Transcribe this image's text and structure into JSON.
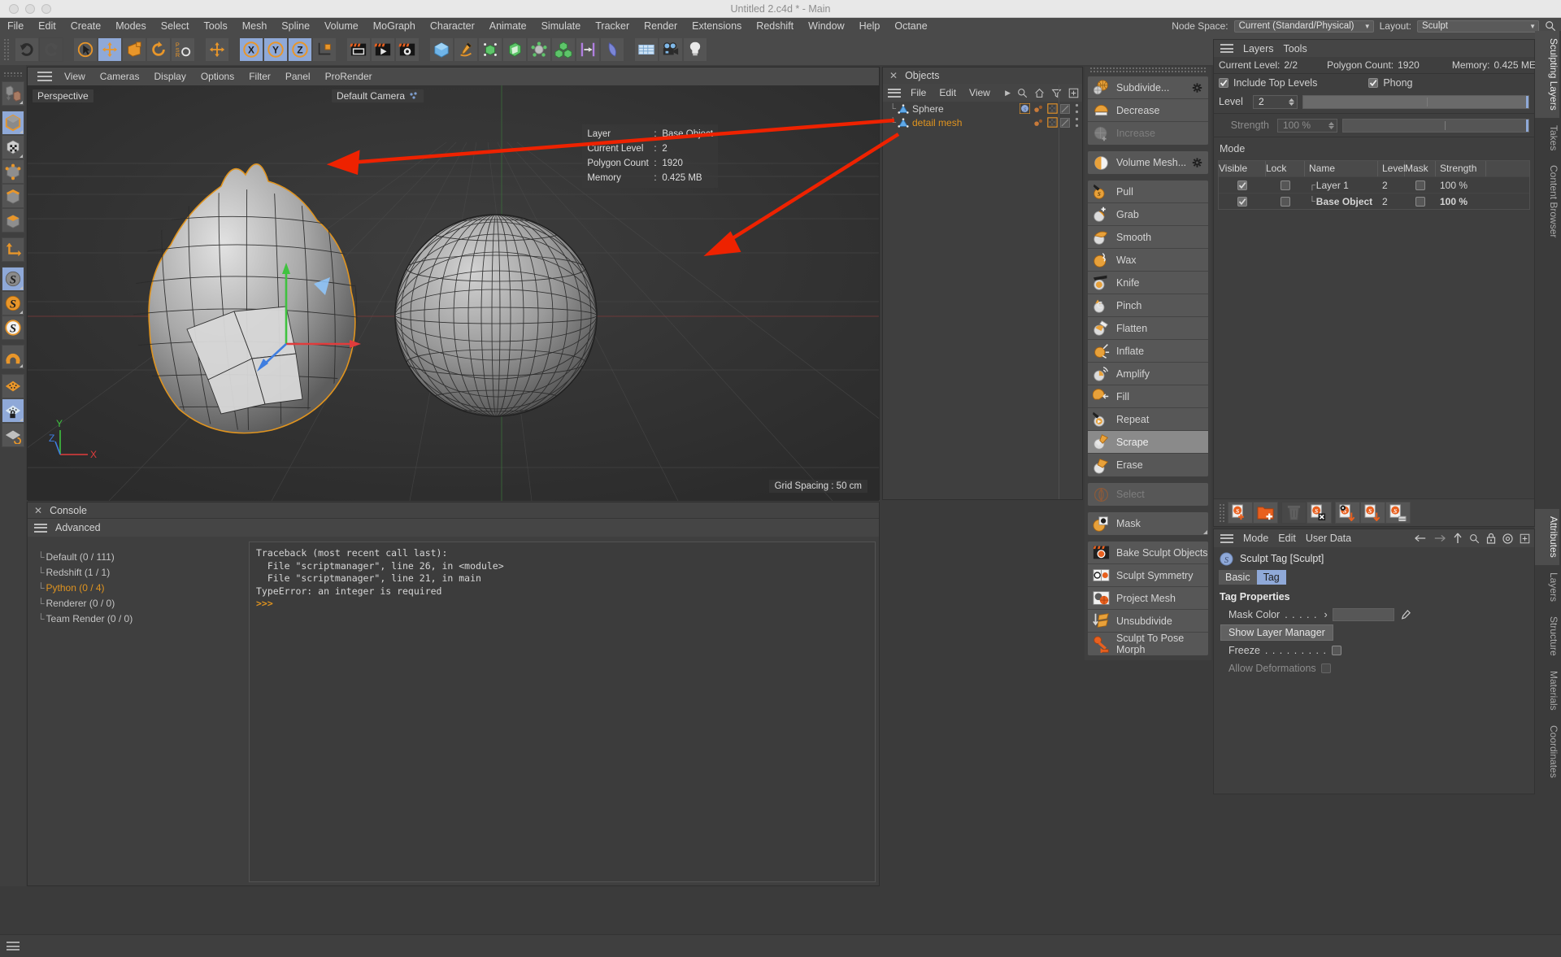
{
  "window": {
    "title": "Untitled 2.c4d * - Main"
  },
  "menubar": {
    "items": [
      "File",
      "Edit",
      "Create",
      "Modes",
      "Select",
      "Tools",
      "Mesh",
      "Spline",
      "Volume",
      "MoGraph",
      "Character",
      "Animate",
      "Simulate",
      "Tracker",
      "Render",
      "Extensions",
      "Redshift",
      "Window",
      "Help",
      "Octane"
    ],
    "node_space_label": "Node Space:",
    "node_space_value": "Current (Standard/Physical)",
    "layout_label": "Layout:",
    "layout_value": "Sculpt",
    "search_icon": "magnifier-icon"
  },
  "toolbar": {
    "groups": [
      {
        "name": "history",
        "buttons": [
          {
            "icon": "undo-icon",
            "label": "Undo",
            "active": false,
            "dim": false
          },
          {
            "icon": "redo-icon",
            "label": "Redo",
            "active": false,
            "dim": true
          }
        ]
      },
      {
        "name": "transform",
        "buttons": [
          {
            "icon": "select-cursor-icon",
            "label": "Live Selection",
            "active": false,
            "dim": false
          },
          {
            "icon": "move-icon",
            "label": "Move",
            "active": true,
            "dim": false
          },
          {
            "icon": "scale-icon",
            "label": "Scale",
            "active": false,
            "dim": false
          },
          {
            "icon": "rotate-icon",
            "label": "Rotate",
            "active": false,
            "dim": false
          },
          {
            "icon": "psr-icon",
            "label": "PSR",
            "active": false,
            "dim": false
          }
        ]
      },
      {
        "name": "world-object",
        "buttons": [
          {
            "icon": "coordinate-move-icon",
            "label": "World/Object",
            "active": false,
            "dim": false
          }
        ]
      },
      {
        "name": "axis-locks",
        "buttons": [
          {
            "icon": "x-axis-icon",
            "label": "X Axis",
            "active": true,
            "dim": false
          },
          {
            "icon": "y-axis-icon",
            "label": "Y Axis",
            "active": true,
            "dim": false
          },
          {
            "icon": "z-axis-icon",
            "label": "Z Axis",
            "active": true,
            "dim": false
          },
          {
            "icon": "world-coordinate-icon",
            "label": "World Coordinates",
            "active": false,
            "dim": false
          }
        ]
      },
      {
        "name": "render",
        "buttons": [
          {
            "icon": "render-view-icon",
            "label": "Render View",
            "active": false,
            "dim": false
          },
          {
            "icon": "render-queue-icon",
            "label": "Render to Picture Viewer",
            "active": false,
            "dim": false
          },
          {
            "icon": "render-settings-icon",
            "label": "Edit Render Settings",
            "active": false,
            "dim": false
          }
        ]
      },
      {
        "name": "create",
        "buttons": [
          {
            "icon": "cube-primitive-icon",
            "label": "Add Cube Object",
            "active": false,
            "dim": false
          },
          {
            "icon": "pen-spline-icon",
            "label": "Add Spline",
            "active": false,
            "dim": false
          },
          {
            "icon": "nurbs-icon",
            "label": "Add Generator",
            "active": false,
            "dim": false
          },
          {
            "icon": "array-icon",
            "label": "Add Modeling Object",
            "active": false,
            "dim": false
          },
          {
            "icon": "deformer-icon",
            "label": "Add Deformer",
            "active": false,
            "dim": false
          },
          {
            "icon": "cloner-icon",
            "label": "Add MoGraph Object",
            "active": false,
            "dim": false
          },
          {
            "icon": "field-icon",
            "label": "Add Field",
            "active": false,
            "dim": false
          },
          {
            "icon": "bend-icon",
            "label": "Add Deformer Object",
            "active": false,
            "dim": false
          }
        ]
      },
      {
        "name": "scene",
        "buttons": [
          {
            "icon": "floor-icon",
            "label": "Add Floor",
            "active": false,
            "dim": false
          },
          {
            "icon": "camera-icon",
            "label": "Add Camera",
            "active": false,
            "dim": false
          },
          {
            "icon": "light-icon",
            "label": "Add Light",
            "active": false,
            "dim": false
          }
        ]
      }
    ]
  },
  "left_tools": [
    {
      "icon": "make-editable-icon",
      "label": "Make Editable",
      "active": false
    },
    {
      "icon": "model-mode-icon",
      "label": "Model Mode",
      "active": true
    },
    {
      "icon": "texture-mode-icon",
      "label": "Texture Mode",
      "active": false
    },
    {
      "icon": "points-mode-icon",
      "label": "Points Mode",
      "active": false
    },
    {
      "icon": "edges-mode-icon",
      "label": "Edges Mode",
      "active": false
    },
    {
      "icon": "polygons-mode-icon",
      "label": "Polygons Mode",
      "active": false
    },
    {
      "icon": "axis-mode-icon",
      "label": "Enable Axis",
      "active": false
    },
    {
      "icon": "sculpt-mode-icon",
      "label": "Sculpt Mode",
      "active": true
    },
    {
      "icon": "sculpt-brush-icon",
      "label": "Sculpt Brush",
      "active": false
    },
    {
      "icon": "sculpt-symmetry-icon",
      "label": "Sculpt Symmetry",
      "active": false
    },
    {
      "icon": "magnet-icon",
      "label": "Magnet",
      "active": false
    },
    {
      "icon": "workplane-icon",
      "label": "Workplane",
      "active": false
    },
    {
      "icon": "lock-workplane-icon",
      "label": "Lock Workplane",
      "active": true
    },
    {
      "icon": "workplane-mode-icon",
      "label": "Planar Workplane",
      "active": false
    }
  ],
  "viewport": {
    "menu": [
      "View",
      "Cameras",
      "Display",
      "Options",
      "Filter",
      "Panel",
      "ProRender"
    ],
    "label": "Perspective",
    "camera": "Default Camera",
    "camera_icon": "camera-dots-icon",
    "hud": [
      {
        "key": "Layer",
        "value": "Base Object"
      },
      {
        "key": "Current Level",
        "value": "2"
      },
      {
        "key": "Polygon Count",
        "value": "1920"
      },
      {
        "key": "Memory",
        "value": "0.425 MB"
      }
    ],
    "grid_spacing": "Grid Spacing : 50 cm",
    "axis_labels": {
      "x": "X",
      "y": "Y",
      "z": "Z"
    },
    "axis_colors": {
      "x": "#e03c3c",
      "y": "#3fc23f",
      "z": "#3f7ee0"
    }
  },
  "console": {
    "title": "Console",
    "close_icon": "close-icon",
    "menu_label": "Advanced",
    "tree": [
      {
        "label": "Default (0 / 111)",
        "highlight": false
      },
      {
        "label": "Redshift (1 / 1)",
        "highlight": false
      },
      {
        "label": "Python (0 / 4)",
        "highlight": true
      },
      {
        "label": "Renderer (0 / 0)",
        "highlight": false
      },
      {
        "label": "Team Render  (0 / 0)",
        "highlight": false
      }
    ],
    "output": [
      "Traceback (most recent call last):",
      "  File \"scriptmanager\", line 26, in <module>",
      "  File \"scriptmanager\", line 21, in main",
      "TypeError: an integer is required"
    ],
    "prompt": ">>>"
  },
  "objects_panel": {
    "title": "Objects",
    "close_icon": "close-icon",
    "menu": [
      "File",
      "Edit",
      "View"
    ],
    "header_icons": [
      "chevron-right-icon",
      "search-icon",
      "home-icon",
      "filter-icon",
      "plus-box-icon"
    ],
    "rows": [
      {
        "name": "Sphere",
        "selected": false,
        "icon": "polygon-object-icon",
        "tags": [
          "sculpt-tag-icon",
          "material-dots-icon",
          "texture-tag-icon"
        ]
      },
      {
        "name": "detail mesh",
        "selected": true,
        "icon": "polygon-object-icon",
        "tags": [
          "material-dots-icon",
          "texture-tag-icon"
        ]
      }
    ]
  },
  "sculpt_tools": {
    "groups": [
      {
        "name": "subdivision",
        "items": [
          {
            "label": "Subdivide...",
            "icon": "subdivide-icon",
            "state": "normal",
            "gear": true
          },
          {
            "label": "Decrease",
            "icon": "decrease-icon",
            "state": "normal",
            "gear": false
          },
          {
            "label": "Increase",
            "icon": "increase-icon",
            "state": "disabled",
            "gear": false
          }
        ]
      },
      {
        "name": "volume",
        "items": [
          {
            "label": "Volume Mesh...",
            "icon": "volume-mesh-icon",
            "state": "normal",
            "gear": true
          }
        ]
      },
      {
        "name": "brushes",
        "items": [
          {
            "label": "Pull",
            "icon": "pull-icon",
            "state": "normal",
            "gear": false
          },
          {
            "label": "Grab",
            "icon": "grab-icon",
            "state": "normal",
            "gear": false
          },
          {
            "label": "Smooth",
            "icon": "smooth-icon",
            "state": "normal",
            "gear": false
          },
          {
            "label": "Wax",
            "icon": "wax-icon",
            "state": "normal",
            "gear": false
          },
          {
            "label": "Knife",
            "icon": "knife-icon",
            "state": "normal",
            "gear": false
          },
          {
            "label": "Pinch",
            "icon": "pinch-icon",
            "state": "normal",
            "gear": false
          },
          {
            "label": "Flatten",
            "icon": "flatten-icon",
            "state": "normal",
            "gear": false
          },
          {
            "label": "Inflate",
            "icon": "inflate-icon",
            "state": "normal",
            "gear": false
          },
          {
            "label": "Amplify",
            "icon": "amplify-icon",
            "state": "normal",
            "gear": false
          },
          {
            "label": "Fill",
            "icon": "fill-icon",
            "state": "normal",
            "gear": false
          },
          {
            "label": "Repeat",
            "icon": "repeat-icon",
            "state": "normal",
            "gear": false
          },
          {
            "label": "Scrape",
            "icon": "scrape-icon",
            "state": "selected",
            "gear": false
          },
          {
            "label": "Erase",
            "icon": "erase-icon",
            "state": "normal",
            "gear": false
          }
        ]
      },
      {
        "name": "selection",
        "items": [
          {
            "label": "Select",
            "icon": "select-sculpt-icon",
            "state": "disabled",
            "gear": false
          }
        ]
      },
      {
        "name": "mask",
        "items": [
          {
            "label": "Mask",
            "icon": "mask-icon",
            "state": "normal",
            "gear": false,
            "corner": true
          }
        ]
      },
      {
        "name": "commands",
        "items": [
          {
            "label": "Bake Sculpt Objects",
            "icon": "bake-sculpt-icon",
            "state": "normal",
            "gear": false
          },
          {
            "label": "Sculpt Symmetry",
            "icon": "sculpt-symmetry-icon",
            "state": "normal",
            "gear": false
          },
          {
            "label": "Project Mesh",
            "icon": "project-mesh-icon",
            "state": "normal",
            "gear": false
          },
          {
            "label": "Unsubdivide",
            "icon": "unsubdivide-icon",
            "state": "normal",
            "gear": false
          },
          {
            "label": "Sculpt To Pose Morph",
            "icon": "pose-morph-icon",
            "state": "normal",
            "gear": false
          }
        ]
      }
    ]
  },
  "layers_panel": {
    "tabs": [
      "Layers",
      "Tools"
    ],
    "active_tab": "Layers",
    "stats": [
      {
        "label": "Current Level:",
        "value": "2/2"
      },
      {
        "label": "Polygon Count:",
        "value": "1920"
      },
      {
        "label": "Memory:",
        "value": "0.425 ME"
      }
    ],
    "include_top_levels": {
      "label": "Include Top Levels",
      "checked": true
    },
    "phong": {
      "label": "Phong",
      "checked": true
    },
    "level": {
      "label": "Level",
      "value": "2"
    },
    "strength": {
      "label": "Strength",
      "value": "100 %",
      "disabled": true
    },
    "mode_label": "Mode",
    "table": {
      "headers": [
        "Visible",
        "Lock",
        "Name",
        "Level",
        "Mask",
        "Strength",
        ""
      ],
      "rows": [
        {
          "visible": true,
          "lock": false,
          "name": "Layer 1",
          "level": "2",
          "mask": false,
          "strength": "100 %",
          "bold": false
        },
        {
          "visible": true,
          "lock": false,
          "name": "Base Object",
          "level": "2",
          "mask": false,
          "strength": "100 %",
          "bold": true
        }
      ]
    },
    "toolbar_buttons": [
      {
        "icon": "add-sculpt-layer-icon",
        "label": "Add Layer",
        "dim": false
      },
      {
        "icon": "add-folder-icon",
        "label": "Add Folder",
        "dim": false
      },
      {
        "icon": "delete-layer-icon",
        "label": "Delete Layer",
        "dim": true
      },
      {
        "icon": "clear-layer-icon",
        "label": "Clear Layer",
        "dim": false
      },
      {
        "icon": "merge-visible-icon",
        "label": "Merge Visible Layers",
        "dim": false
      },
      {
        "icon": "merge-down-icon",
        "label": "Merge Layer Down",
        "dim": false
      },
      {
        "icon": "flatten-layers-icon",
        "label": "Flatten Layers",
        "dim": false
      }
    ]
  },
  "attributes_panel": {
    "menu": [
      "Mode",
      "Edit",
      "User Data"
    ],
    "header_icons": [
      "back-arrow-icon",
      "forward-arrow-icon",
      "up-arrow-icon",
      "search-icon",
      "lock-icon",
      "target-icon",
      "plus-box-icon"
    ],
    "object_icon": "sculpt-tag-icon",
    "object_title": "Sculpt Tag [Sculpt]",
    "tabs": [
      {
        "label": "Basic",
        "active": false
      },
      {
        "label": "Tag",
        "active": true
      }
    ],
    "section_title": "Tag Properties",
    "rows": [
      {
        "type": "color",
        "label": "Mask Color",
        "dots": ". . . . .",
        "arrow": "›",
        "eyedropper": "eyedropper-icon"
      },
      {
        "type": "button",
        "label": "Show Layer Manager"
      },
      {
        "type": "check",
        "label": "Freeze",
        "dots": ". . . . . . . . .",
        "checked": false,
        "disabled": false
      },
      {
        "type": "check",
        "label": "Allow Deformations",
        "dots": "",
        "checked": false,
        "disabled": true
      }
    ]
  },
  "right_tabs": [
    {
      "label": "Sculpting Layers",
      "active": true
    },
    {
      "label": "Takes",
      "active": false
    },
    {
      "label": "Content Browser",
      "active": false
    },
    {
      "label": "Attributes",
      "active": true
    },
    {
      "label": "Layers",
      "active": false
    },
    {
      "label": "Structure",
      "active": false
    },
    {
      "label": "Materials",
      "active": false
    },
    {
      "label": "Coordinates",
      "active": false
    }
  ],
  "colors": {
    "accent_orange": "#e0941f",
    "accent_blue": "#8fa9d8",
    "annotation_red": "#ee2200",
    "panel_bg": "#3f3f3f",
    "toolbar_bg": "#4a4a4a"
  }
}
